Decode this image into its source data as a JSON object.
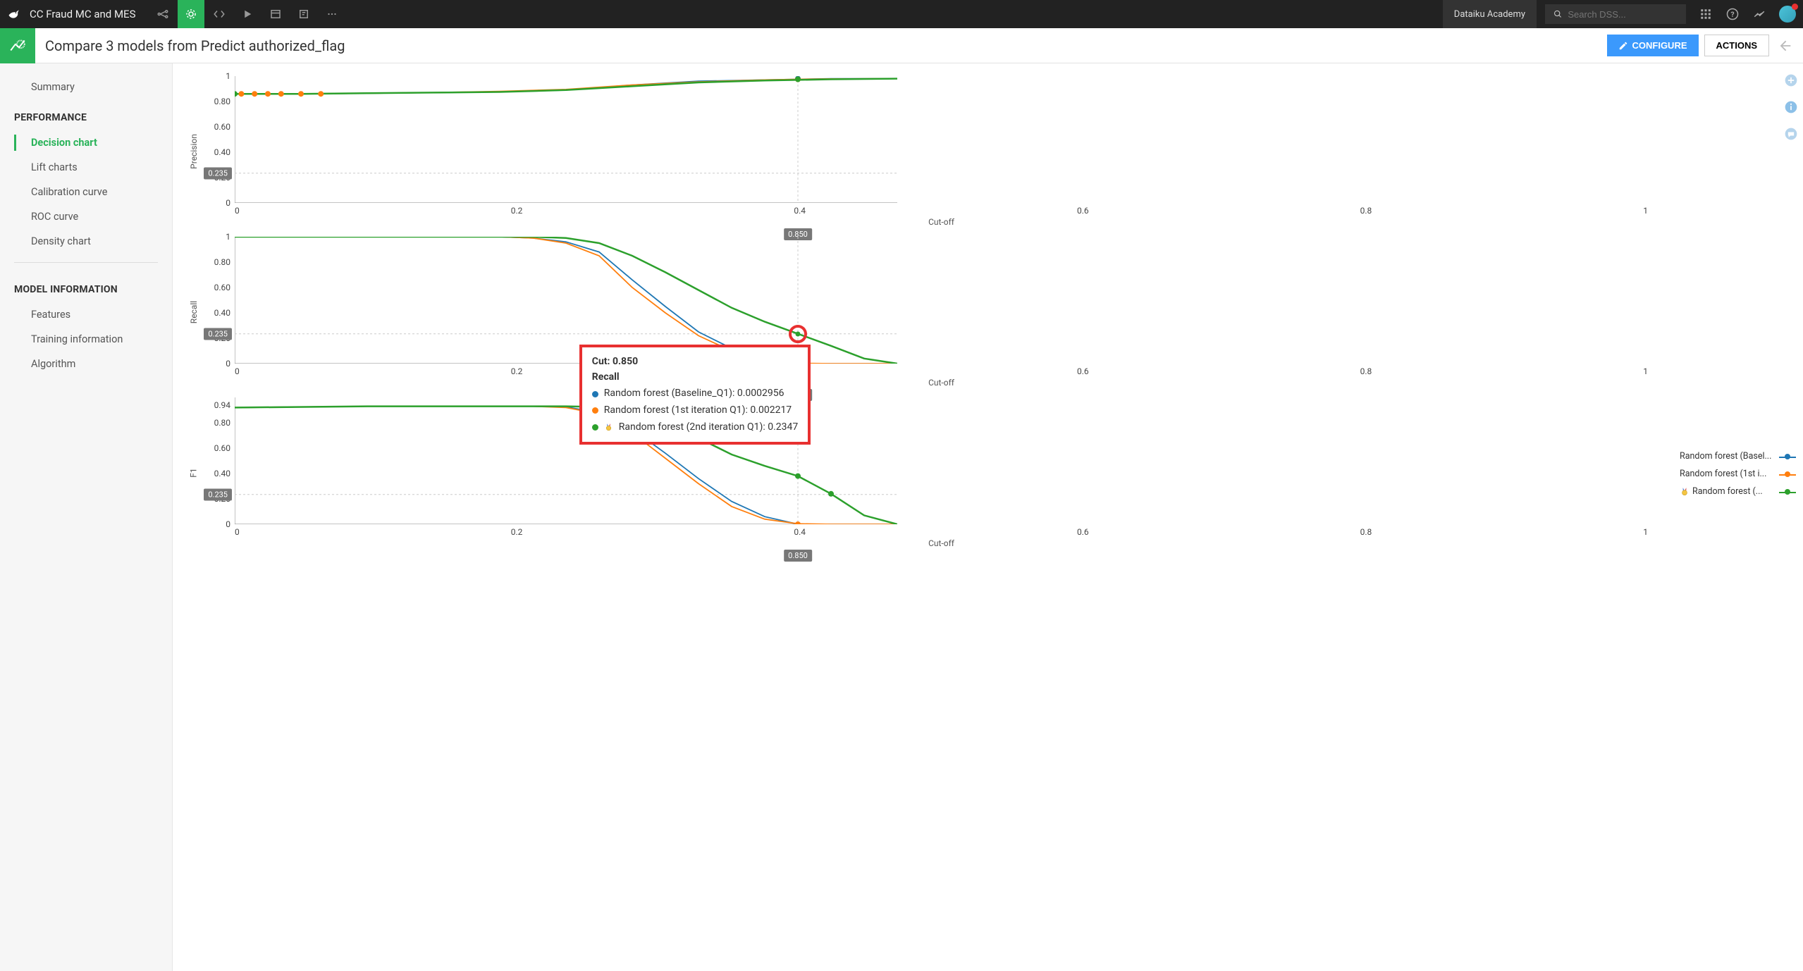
{
  "top_nav": {
    "project_title": "CC Fraud MC and MES",
    "academy_link": "Dataiku Academy",
    "search_placeholder": "Search DSS..."
  },
  "header": {
    "page_title": "Compare 3 models from Predict authorized_flag",
    "configure_label": "CONFIGURE",
    "actions_label": "ACTIONS"
  },
  "sidebar": {
    "summary": "Summary",
    "section_performance": "PERFORMANCE",
    "perf_items": [
      "Decision chart",
      "Lift charts",
      "Calibration curve",
      "ROC curve",
      "Density chart"
    ],
    "section_model_info": "MODEL INFORMATION",
    "mi_items": [
      "Features",
      "Training information",
      "Algorithm"
    ]
  },
  "legend": {
    "items": [
      {
        "label": "Random forest (Basel...",
        "color": "#1f77b4"
      },
      {
        "label": "Random forest (1st i...",
        "color": "#ff7f0e"
      },
      {
        "label": "Random forest (...",
        "color": "#2ca02c",
        "medal": true
      }
    ]
  },
  "tooltip": {
    "title_line": "Cut: 0.850",
    "metric_line": "Recall",
    "rows": [
      {
        "color": "#1f77b4",
        "text": "Random forest (Baseline_Q1): 0.0002956"
      },
      {
        "color": "#ff7f0e",
        "text": "Random forest (1st iteration Q1): 0.002217"
      },
      {
        "color": "#2ca02c",
        "medal": true,
        "text": "Random forest (2nd iteration Q1): 0.2347"
      }
    ]
  },
  "chart_data": [
    {
      "type": "line",
      "title": "",
      "ylabel": "Precision",
      "xlabel": "Cut-off",
      "xlim": [
        0,
        1
      ],
      "ylim": [
        0,
        1
      ],
      "yticks": [
        0,
        0.2,
        0.4,
        0.6,
        0.8,
        1
      ],
      "xticks": [
        0,
        0.2,
        0.4,
        0.6,
        0.8,
        1
      ],
      "ref_y": 0.235,
      "ref_x": 0.85,
      "ref_x_label": "0.850",
      "ref_y_label": "0.235",
      "markers_orange_x": [
        0.01,
        0.03,
        0.05,
        0.07,
        0.1,
        0.13
      ],
      "markers_orange_y": 0.86,
      "marker_green_x": 0.0,
      "marker_green_y": 0.86,
      "marker_blue_at_ref": 0.98,
      "marker_orange_at_ref": 0.975,
      "marker_green_at_ref": 0.975,
      "series": [
        {
          "name": "Random forest (Baseline_Q1)",
          "color": "#1f77b4",
          "x": [
            0,
            0.1,
            0.2,
            0.3,
            0.4,
            0.5,
            0.6,
            0.7,
            0.8,
            0.85,
            0.9,
            1.0
          ],
          "y": [
            0.86,
            0.86,
            0.865,
            0.87,
            0.875,
            0.89,
            0.93,
            0.96,
            0.97,
            0.975,
            0.98,
            0.98
          ]
        },
        {
          "name": "Random forest (1st iteration Q1)",
          "color": "#ff7f0e",
          "x": [
            0,
            0.1,
            0.2,
            0.3,
            0.4,
            0.5,
            0.6,
            0.7,
            0.8,
            0.85,
            0.9,
            1.0
          ],
          "y": [
            0.86,
            0.86,
            0.865,
            0.87,
            0.88,
            0.895,
            0.93,
            0.955,
            0.97,
            0.975,
            0.978,
            0.98
          ]
        },
        {
          "name": "Random forest (2nd iteration Q1)",
          "color": "#2ca02c",
          "x": [
            0,
            0.1,
            0.2,
            0.3,
            0.4,
            0.5,
            0.6,
            0.7,
            0.8,
            0.85,
            0.9,
            1.0
          ],
          "y": [
            0.86,
            0.86,
            0.865,
            0.87,
            0.875,
            0.89,
            0.92,
            0.95,
            0.965,
            0.97,
            0.975,
            0.98
          ]
        }
      ]
    },
    {
      "type": "line",
      "ylabel": "Recall",
      "xlabel": "Cut-off",
      "xlim": [
        0,
        1
      ],
      "ylim": [
        0,
        1
      ],
      "yticks": [
        0,
        0.2,
        0.4,
        0.6,
        0.8,
        1
      ],
      "xticks": [
        0,
        0.2,
        0.4,
        0.6,
        0.8,
        1
      ],
      "ref_y": 0.235,
      "ref_x": 0.85,
      "ref_x_label": "0.850",
      "ref_y_label": "0.235",
      "series": [
        {
          "name": "Random forest (Baseline_Q1)",
          "color": "#1f77b4",
          "x": [
            0,
            0.2,
            0.4,
            0.45,
            0.5,
            0.55,
            0.6,
            0.65,
            0.7,
            0.75,
            0.8,
            0.85,
            0.9,
            1.0
          ],
          "y": [
            1,
            1,
            1,
            0.99,
            0.96,
            0.88,
            0.66,
            0.45,
            0.25,
            0.12,
            0.04,
            0.0003,
            0,
            0
          ]
        },
        {
          "name": "Random forest (1st iteration Q1)",
          "color": "#ff7f0e",
          "x": [
            0,
            0.2,
            0.4,
            0.45,
            0.5,
            0.55,
            0.6,
            0.65,
            0.7,
            0.75,
            0.8,
            0.85,
            0.9,
            1.0
          ],
          "y": [
            1,
            1,
            1,
            0.99,
            0.95,
            0.85,
            0.6,
            0.4,
            0.22,
            0.1,
            0.03,
            0.0022,
            0,
            0
          ]
        },
        {
          "name": "Random forest (2nd iteration Q1)",
          "color": "#2ca02c",
          "x": [
            0,
            0.2,
            0.4,
            0.45,
            0.5,
            0.55,
            0.6,
            0.65,
            0.7,
            0.75,
            0.8,
            0.85,
            0.9,
            0.95,
            1.0
          ],
          "y": [
            1,
            1,
            1,
            1,
            0.99,
            0.95,
            0.85,
            0.72,
            0.58,
            0.44,
            0.33,
            0.235,
            0.14,
            0.04,
            0
          ]
        }
      ],
      "highlight": {
        "x": 0.85,
        "y": 0.235
      }
    },
    {
      "type": "line",
      "ylabel": "F1",
      "xlabel": "Cut-off",
      "xlim": [
        0,
        1
      ],
      "ylim": [
        0,
        1
      ],
      "yticks": [
        0,
        0.2,
        0.4,
        0.6,
        0.8,
        0.94
      ],
      "xticks": [
        0,
        0.2,
        0.4,
        0.6,
        0.8,
        1
      ],
      "ref_y": 0.235,
      "ref_x": 0.85,
      "ref_x_label": "0.850",
      "ref_y_label": "0.235",
      "marker_green_at_ref": 0.38,
      "marker_orange_at_ref": 0.0,
      "marker_green_extra_x": 0.9,
      "marker_green_extra_y": 0.24,
      "series": [
        {
          "name": "Random forest (Baseline_Q1)",
          "color": "#1f77b4",
          "x": [
            0,
            0.2,
            0.4,
            0.45,
            0.5,
            0.55,
            0.6,
            0.65,
            0.7,
            0.75,
            0.8,
            0.85,
            0.9,
            1.0
          ],
          "y": [
            0.92,
            0.93,
            0.93,
            0.93,
            0.925,
            0.88,
            0.75,
            0.56,
            0.36,
            0.18,
            0.06,
            0.0006,
            0,
            0
          ]
        },
        {
          "name": "Random forest (1st iteration Q1)",
          "color": "#ff7f0e",
          "x": [
            0,
            0.2,
            0.4,
            0.45,
            0.5,
            0.55,
            0.6,
            0.65,
            0.7,
            0.75,
            0.8,
            0.85,
            0.9,
            1.0
          ],
          "y": [
            0.92,
            0.93,
            0.93,
            0.93,
            0.92,
            0.87,
            0.72,
            0.52,
            0.32,
            0.14,
            0.04,
            0.004,
            0,
            0
          ]
        },
        {
          "name": "Random forest (2nd iteration Q1)",
          "color": "#2ca02c",
          "x": [
            0,
            0.2,
            0.4,
            0.45,
            0.5,
            0.55,
            0.6,
            0.65,
            0.7,
            0.75,
            0.8,
            0.85,
            0.9,
            0.95,
            1.0
          ],
          "y": [
            0.92,
            0.93,
            0.93,
            0.93,
            0.93,
            0.925,
            0.89,
            0.8,
            0.68,
            0.55,
            0.46,
            0.38,
            0.24,
            0.07,
            0
          ]
        }
      ]
    }
  ]
}
